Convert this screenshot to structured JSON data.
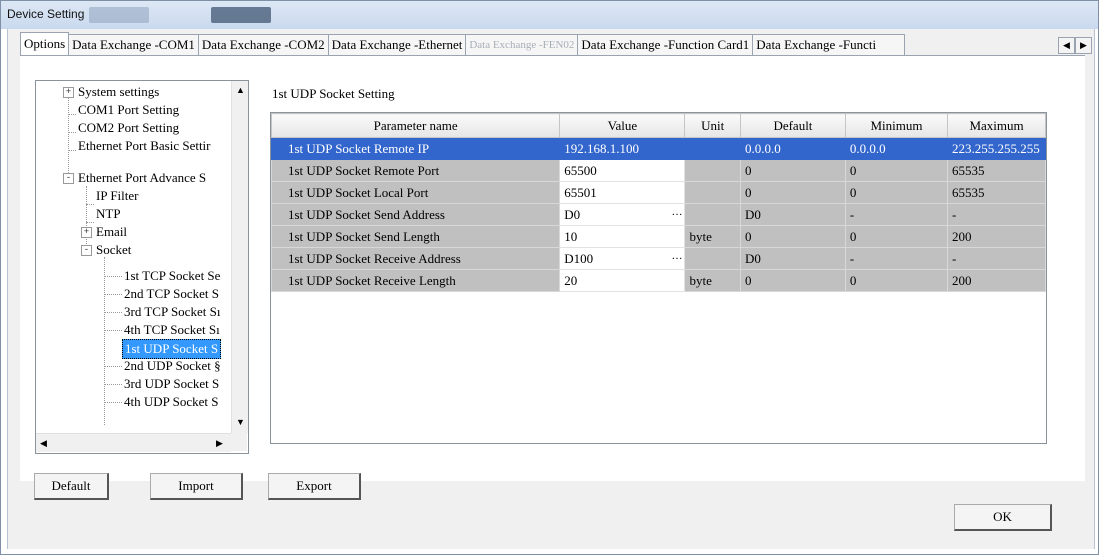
{
  "window": {
    "title": "Device Setting"
  },
  "tabs": [
    {
      "label": "Options",
      "state": "active"
    },
    {
      "label": "Data Exchange -COM1",
      "state": "normal"
    },
    {
      "label": "Data Exchange -COM2",
      "state": "normal"
    },
    {
      "label": "Data Exchange -Ethernet",
      "state": "normal"
    },
    {
      "label": "Data Exchange -FEN02",
      "state": "disabled"
    },
    {
      "label": "Data Exchange -Function Card1",
      "state": "normal"
    },
    {
      "label": "Data Exchange -Functi",
      "state": "normal"
    }
  ],
  "tree": {
    "items": [
      {
        "label": "System settings",
        "expander": "+"
      },
      {
        "label": "COM1 Port Setting"
      },
      {
        "label": "COM2 Port Setting"
      },
      {
        "label": "Ethernet Port Basic Settir"
      },
      {
        "label": "Ethernet Port Advance S",
        "expander": "-"
      },
      {
        "label": "IP Filter"
      },
      {
        "label": "NTP"
      },
      {
        "label": "Email",
        "expander": "+"
      },
      {
        "label": "Socket",
        "expander": "-"
      },
      {
        "label": "1st TCP Socket Se"
      },
      {
        "label": "2nd TCP Socket S"
      },
      {
        "label": "3rd TCP Socket Sı"
      },
      {
        "label": "4th TCP Socket Sı"
      },
      {
        "label": "1st UDP Socket S",
        "selected": true
      },
      {
        "label": "2nd UDP Socket §"
      },
      {
        "label": "3rd UDP Socket S"
      },
      {
        "label": "4th UDP Socket S"
      }
    ]
  },
  "section": {
    "title": "1st UDP Socket Setting"
  },
  "table": {
    "headers": [
      "Parameter name",
      "Value",
      "Unit",
      "Default",
      "Minimum",
      "Maximum"
    ],
    "rows": [
      {
        "name": "1st UDP Socket Remote IP",
        "value": "192.168.1.100",
        "unit": "",
        "default": "0.0.0.0",
        "min": "0.0.0.0",
        "max": "223.255.255.255",
        "selected": true
      },
      {
        "name": "1st UDP Socket Remote Port",
        "value": "65500",
        "unit": "",
        "default": "0",
        "min": "0",
        "max": "65535"
      },
      {
        "name": "1st UDP Socket Local Port",
        "value": "65501",
        "unit": "",
        "default": "0",
        "min": "0",
        "max": "65535"
      },
      {
        "name": "1st UDP Socket Send Address",
        "value": "D0",
        "unit": "",
        "default": "D0",
        "min": "-",
        "max": "-",
        "browse": true
      },
      {
        "name": "1st UDP Socket Send Length",
        "value": "10",
        "unit": "byte",
        "default": "0",
        "min": "0",
        "max": "200"
      },
      {
        "name": "1st UDP Socket Receive Address",
        "value": "D100",
        "unit": "",
        "default": "D0",
        "min": "-",
        "max": "-",
        "browse": true
      },
      {
        "name": "1st UDP Socket Receive Length",
        "value": "20",
        "unit": "byte",
        "default": "0",
        "min": "0",
        "max": "200"
      }
    ]
  },
  "buttons": {
    "default": "Default",
    "import": "Import",
    "export": "Export",
    "ok": "OK"
  },
  "icons": {
    "browse": "ellipsis-icon",
    "tab_left": "chevron-left-icon",
    "tab_right": "chevron-right-icon"
  }
}
